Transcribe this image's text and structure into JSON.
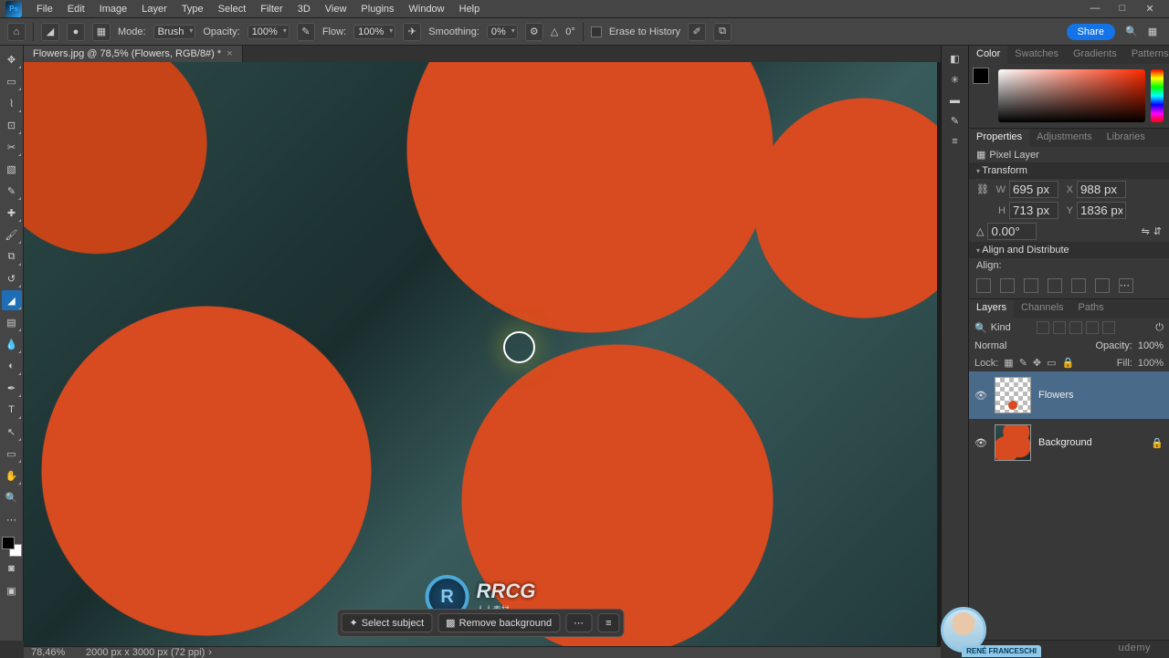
{
  "menu": {
    "items": [
      "File",
      "Edit",
      "Image",
      "Layer",
      "Type",
      "Select",
      "Filter",
      "3D",
      "View",
      "Plugins",
      "Window",
      "Help"
    ]
  },
  "winbtns": [
    "—",
    "□",
    "✕"
  ],
  "options": {
    "mode_label": "Mode:",
    "mode_value": "Brush",
    "opacity_label": "Opacity:",
    "opacity_value": "100%",
    "flow_label": "Flow:",
    "flow_value": "100%",
    "smoothing_label": "Smoothing:",
    "smoothing_value": "0%",
    "angle_value": "0°",
    "erase_history": "Erase to History",
    "share": "Share"
  },
  "tab": {
    "title": "Flowers.jpg @ 78,5% (Flowers, RGB/8#) *"
  },
  "status": {
    "zoom": "78,46%",
    "dims": "2000 px x 3000 px (72 ppi)"
  },
  "context_actions": {
    "select_subject": "Select subject",
    "remove_bg": "Remove background"
  },
  "watermark": {
    "text": "RRCG",
    "sub": "人人素材"
  },
  "panels": {
    "color_tabs": [
      "Color",
      "Swatches",
      "Gradients",
      "Patterns"
    ],
    "props_tabs": [
      "Properties",
      "Adjustments",
      "Libraries"
    ],
    "layers_tabs": [
      "Layers",
      "Channels",
      "Paths"
    ]
  },
  "properties": {
    "layer_type": "Pixel Layer",
    "transform_label": "Transform",
    "W": "695 px",
    "X": "988 px",
    "H": "713 px",
    "Y": "1836 px",
    "angle": "0.00°",
    "align_label": "Align and Distribute",
    "align_sub": "Align:"
  },
  "layers": {
    "kind_label": "Kind",
    "blend_mode": "Normal",
    "opacity_label": "Opacity:",
    "opacity_value": "100%",
    "lock_label": "Lock:",
    "fill_label": "Fill:",
    "fill_value": "100%",
    "items": [
      {
        "name": "Flowers",
        "locked": false
      },
      {
        "name": "Background",
        "locked": true
      }
    ]
  },
  "instructor": "RENÉ FRANCESCHI",
  "brand": "udemy"
}
